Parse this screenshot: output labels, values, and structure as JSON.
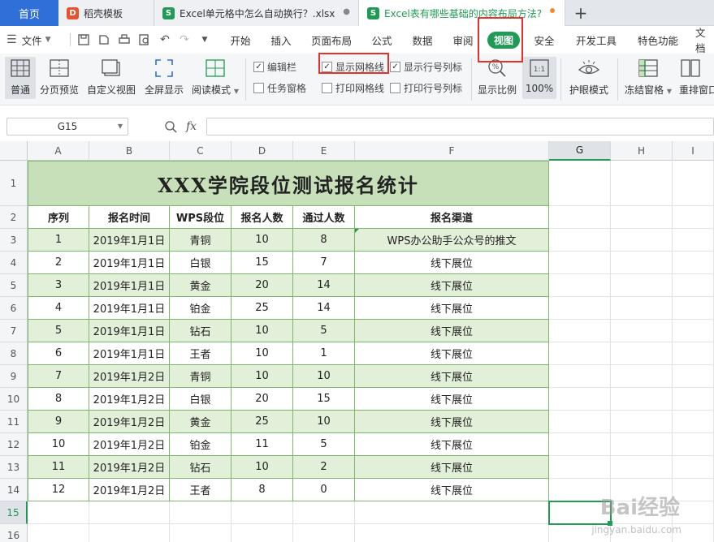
{
  "tabs": {
    "home": "首页",
    "doc1": "稻壳模板",
    "doc2": "Excel单元格中怎么自动换行？.xlsx",
    "doc3": "Excel表有哪些基础的内容布局方法?",
    "close_glyph": "●"
  },
  "menu": {
    "file": "文件",
    "items": [
      "开始",
      "插入",
      "页面布局",
      "公式",
      "数据",
      "审阅",
      "视图",
      "安全",
      "开发工具",
      "特色功能",
      "文档"
    ],
    "active": "视图"
  },
  "ribbon": {
    "normal": "普通",
    "page_break": "分页预览",
    "custom_view": "自定义视图",
    "fullscreen": "全屏显示",
    "reading_mode": "阅读模式",
    "cb_edit_bar": "编辑栏",
    "cb_gridlines": "显示网格线",
    "cb_headers": "显示行号列标",
    "cb_task_pane": "任务窗格",
    "cb_print_grid": "打印网格线",
    "cb_print_headers": "打印行号列标",
    "zoom_ratio": "显示比例",
    "zoom_value": "100%",
    "eye_mode": "护眼模式",
    "freeze": "冻结窗格",
    "rearrange": "重排窗口",
    "checked": {
      "edit_bar": true,
      "gridlines": true,
      "headers": true,
      "task_pane": false,
      "print_grid": false,
      "print_headers": false
    }
  },
  "formula_bar": {
    "name_box": "G15",
    "fx": "fx"
  },
  "sheet": {
    "columns": [
      "A",
      "B",
      "C",
      "D",
      "E",
      "F",
      "G",
      "H",
      "I"
    ],
    "rows": [
      "1",
      "2",
      "3",
      "4",
      "5",
      "6",
      "7",
      "8",
      "9",
      "10",
      "11",
      "12",
      "13",
      "14",
      "15",
      "16"
    ],
    "title": "XXX学院段位测试报名统计",
    "headers": [
      "序列",
      "报名时间",
      "WPS段位",
      "报名人数",
      "通过人数",
      "报名渠道"
    ],
    "data": [
      [
        "1",
        "2019年1月1日",
        "青铜",
        "10",
        "8",
        "WPS办公助手公众号的推文"
      ],
      [
        "2",
        "2019年1月1日",
        "白银",
        "15",
        "7",
        "线下展位"
      ],
      [
        "3",
        "2019年1月1日",
        "黄金",
        "20",
        "14",
        "线下展位"
      ],
      [
        "4",
        "2019年1月1日",
        "铂金",
        "25",
        "14",
        "线下展位"
      ],
      [
        "5",
        "2019年1月1日",
        "钻石",
        "10",
        "5",
        "线下展位"
      ],
      [
        "6",
        "2019年1月1日",
        "王者",
        "10",
        "1",
        "线下展位"
      ],
      [
        "7",
        "2019年1月2日",
        "青铜",
        "10",
        "10",
        "线下展位"
      ],
      [
        "8",
        "2019年1月2日",
        "白银",
        "20",
        "15",
        "线下展位"
      ],
      [
        "9",
        "2019年1月2日",
        "黄金",
        "25",
        "10",
        "线下展位"
      ],
      [
        "10",
        "2019年1月2日",
        "铂金",
        "11",
        "5",
        "线下展位"
      ],
      [
        "11",
        "2019年1月2日",
        "钻石",
        "10",
        "2",
        "线下展位"
      ],
      [
        "12",
        "2019年1月2日",
        "王者",
        "8",
        "0",
        "线下展位"
      ]
    ],
    "selected_cell": "G15"
  },
  "watermark": {
    "main": "Bai经验",
    "sub": "jingyan.baidu.com"
  },
  "colors": {
    "accent": "#1f9b55",
    "tab_blue": "#2f6fd8",
    "title_fill": "#c8e0b9",
    "band_fill": "#e2efd9",
    "highlight": "#e8302a"
  }
}
